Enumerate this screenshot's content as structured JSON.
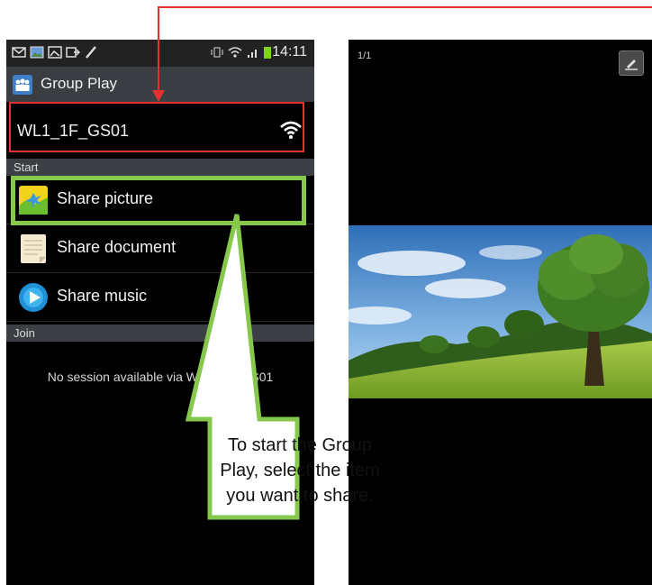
{
  "status_bar": {
    "time": "14:11",
    "left_icons": [
      "mail-icon",
      "image-icon",
      "gallery-icon",
      "notification-icon",
      "brush-icon"
    ],
    "right_icons": [
      "vibrate-icon",
      "wifi-icon",
      "signal-icon",
      "battery-icon"
    ]
  },
  "app": {
    "title": "Group Play",
    "icon": "group-play-icon"
  },
  "network": {
    "ssid": "WL1_1F_GS01",
    "icon": "wifi-icon"
  },
  "sections": {
    "start": "Start",
    "join": "Join"
  },
  "items": [
    {
      "label": "Share picture",
      "icon": "picture-icon"
    },
    {
      "label": "Share document",
      "icon": "document-icon"
    },
    {
      "label": "Share music",
      "icon": "music-icon"
    }
  ],
  "join_message": "No session available via WL1_1F_GS01",
  "callout": {
    "text": "To start the Group Play, select the item you want to share."
  },
  "viewer": {
    "counter": "1/1",
    "edit_icon": "edit-icon"
  },
  "colors": {
    "red_highlight": "#e53030",
    "green_highlight": "#86c84c"
  }
}
